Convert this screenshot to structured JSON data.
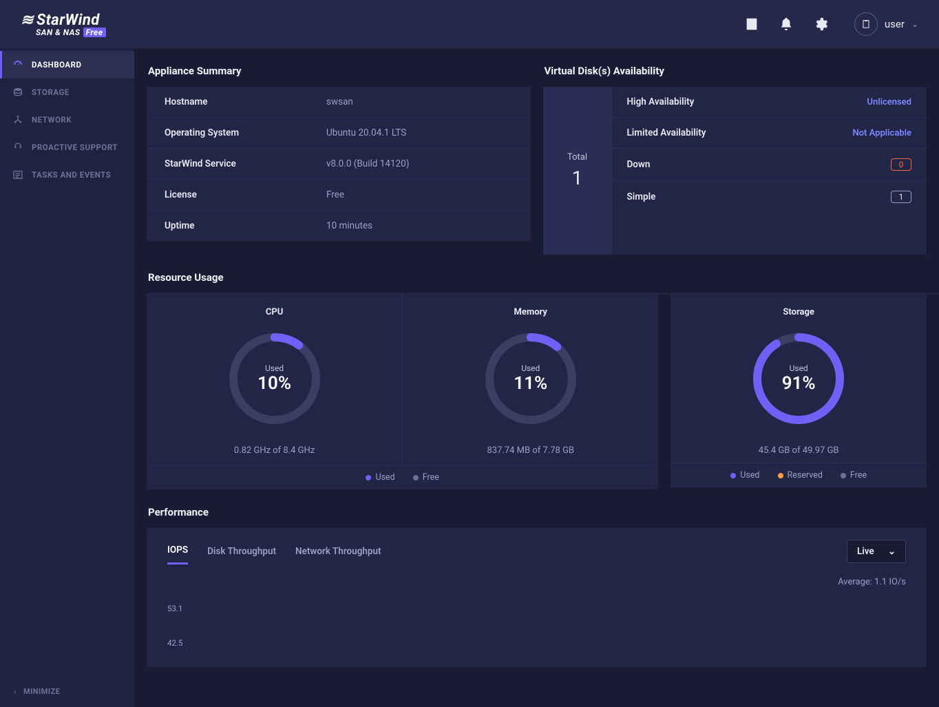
{
  "header": {
    "brand_top": "StarWind",
    "brand_sub_left": "SAN & NAS",
    "brand_sub_badge": "Free",
    "user_label": "user"
  },
  "sidebar": {
    "items": [
      {
        "label": "DASHBOARD"
      },
      {
        "label": "STORAGE"
      },
      {
        "label": "NETWORK"
      },
      {
        "label": "PROACTIVE SUPPORT"
      },
      {
        "label": "TASKS AND EVENTS"
      }
    ],
    "minimize_label": "MINIMIZE"
  },
  "summary": {
    "title": "Appliance Summary",
    "rows": [
      {
        "label": "Hostname",
        "value": "swsan"
      },
      {
        "label": "Operating System",
        "value": "Ubuntu 20.04.1 LTS"
      },
      {
        "label": "StarWind Service",
        "value": "v8.0.0 (Build 14120)"
      },
      {
        "label": "License",
        "value": "Free"
      },
      {
        "label": "Uptime",
        "value": "10 minutes"
      }
    ]
  },
  "vdisks": {
    "title": "Virtual Disk(s) Availability",
    "total_label": "Total",
    "total_value": "1",
    "rows": [
      {
        "label": "High Availability",
        "value": "Unlicensed",
        "kind": "link"
      },
      {
        "label": "Limited Availability",
        "value": "Not Applicable",
        "kind": "link"
      },
      {
        "label": "Down",
        "value": "0",
        "kind": "red"
      },
      {
        "label": "Simple",
        "value": "1",
        "kind": "white"
      }
    ]
  },
  "resource": {
    "title": "Resource Usage",
    "used_label": "Used",
    "free_label": "Free",
    "reserved_label": "Reserved",
    "cards": [
      {
        "name": "CPU",
        "pct": "10%",
        "sub": "0.82 GHz of 8.4 GHz",
        "value": 10
      },
      {
        "name": "Memory",
        "pct": "11%",
        "sub": "837.74 MB of 7.78 GB",
        "value": 11
      },
      {
        "name": "Storage",
        "pct": "91%",
        "sub": "45.4 GB of 49.97 GB",
        "value": 91
      }
    ]
  },
  "performance": {
    "title": "Performance",
    "tabs": [
      {
        "label": "IOPS"
      },
      {
        "label": "Disk Throughput"
      },
      {
        "label": "Network Throughput"
      }
    ],
    "live_label": "Live",
    "average": "Average: 1.1 IO/s",
    "ticks": [
      "53.1",
      "42.5"
    ]
  },
  "chart_data": [
    {
      "type": "pie",
      "title": "CPU",
      "values": [
        10,
        90
      ],
      "labels": [
        "Used",
        "Free"
      ]
    },
    {
      "type": "pie",
      "title": "Memory",
      "values": [
        11,
        89
      ],
      "labels": [
        "Used",
        "Free"
      ]
    },
    {
      "type": "pie",
      "title": "Storage",
      "values": [
        91,
        9
      ],
      "labels": [
        "Used",
        "Free"
      ]
    },
    {
      "type": "line",
      "title": "IOPS",
      "ylim": [
        0,
        53.1
      ],
      "ylabel": "IO/s",
      "average": 1.1,
      "y_ticks": [
        53.1,
        42.5
      ]
    }
  ]
}
